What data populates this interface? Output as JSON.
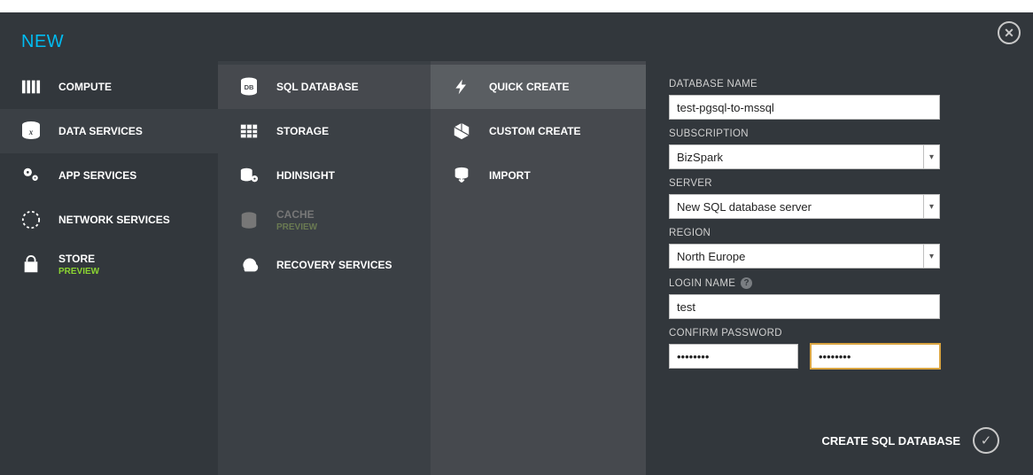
{
  "header": {
    "title": "NEW"
  },
  "col1": {
    "items": [
      {
        "label": "COMPUTE",
        "icon": "compute-icon"
      },
      {
        "label": "DATA SERVICES",
        "icon": "data-services-icon",
        "selected": true
      },
      {
        "label": "APP SERVICES",
        "icon": "app-services-icon"
      },
      {
        "label": "NETWORK SERVICES",
        "icon": "network-services-icon"
      },
      {
        "label": "STORE",
        "sub": "PREVIEW",
        "icon": "store-icon"
      }
    ]
  },
  "col2": {
    "items": [
      {
        "label": "SQL DATABASE",
        "icon": "sql-database-icon",
        "selected": true
      },
      {
        "label": "STORAGE",
        "icon": "storage-icon"
      },
      {
        "label": "HDINSIGHT",
        "icon": "hdinsight-icon"
      },
      {
        "label": "CACHE",
        "sub": "PREVIEW",
        "icon": "cache-icon",
        "disabled": true
      },
      {
        "label": "RECOVERY SERVICES",
        "icon": "recovery-services-icon"
      }
    ]
  },
  "col3": {
    "items": [
      {
        "label": "QUICK CREATE",
        "icon": "quick-create-icon",
        "selected": true
      },
      {
        "label": "CUSTOM CREATE",
        "icon": "custom-create-icon"
      },
      {
        "label": "IMPORT",
        "icon": "import-icon"
      }
    ]
  },
  "form": {
    "database_name": {
      "label": "DATABASE NAME",
      "value": "test-pgsql-to-mssql"
    },
    "subscription": {
      "label": "SUBSCRIPTION",
      "value": "BizSpark"
    },
    "server": {
      "label": "SERVER",
      "value": "New SQL database server"
    },
    "region": {
      "label": "REGION",
      "value": "North Europe"
    },
    "login_name": {
      "label": "LOGIN NAME",
      "value": "test"
    },
    "confirm_password": {
      "label": "CONFIRM PASSWORD",
      "value1": "••••••••",
      "value2": "••••••••"
    }
  },
  "footer": {
    "create_label": "CREATE SQL DATABASE"
  }
}
